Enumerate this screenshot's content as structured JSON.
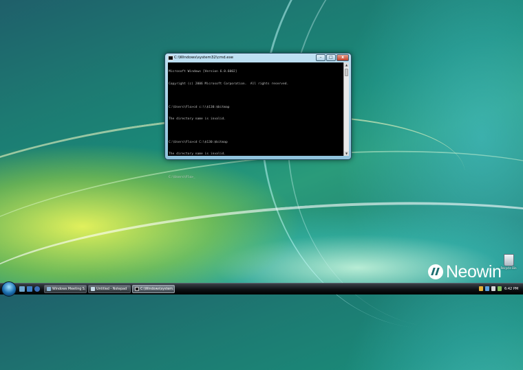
{
  "console_window": {
    "title": "C:\\Windows\\system32\\cmd.exe",
    "lines": [
      "Microsoft Windows [Version 6.0.6002]",
      "Copyright (c) 2006 Microsoft Corporation.  All rights reserved.",
      "",
      "C:\\Users\\Flo>cd c:\\\\$130:$bitmap",
      "The directory name is invalid.",
      "",
      "C:\\Users\\Flo>cd C:\\$130:$bitmap",
      "The directory name is invalid.",
      "",
      "C:\\Users\\Flo>_"
    ],
    "buttons": {
      "minimize": "–",
      "maximize": "□",
      "close": "x"
    }
  },
  "desktop": {
    "recycle_bin_label": "Recycle Bin"
  },
  "watermark": {
    "text": "Neowin"
  },
  "taskbar": {
    "tasks": [
      {
        "label": "Windows Meeting S...",
        "icon_color": "#8fb8d8"
      },
      {
        "label": "Untitled - Notepad",
        "icon_color": "#c7dbe8"
      },
      {
        "label": "C:\\Windows\\system...",
        "icon_color": "#202020"
      }
    ],
    "clock": "6:42 PM"
  },
  "colors": {
    "console_bg": "#000000",
    "console_text": "#c0c0c0",
    "taskbar": "#0d1114"
  }
}
